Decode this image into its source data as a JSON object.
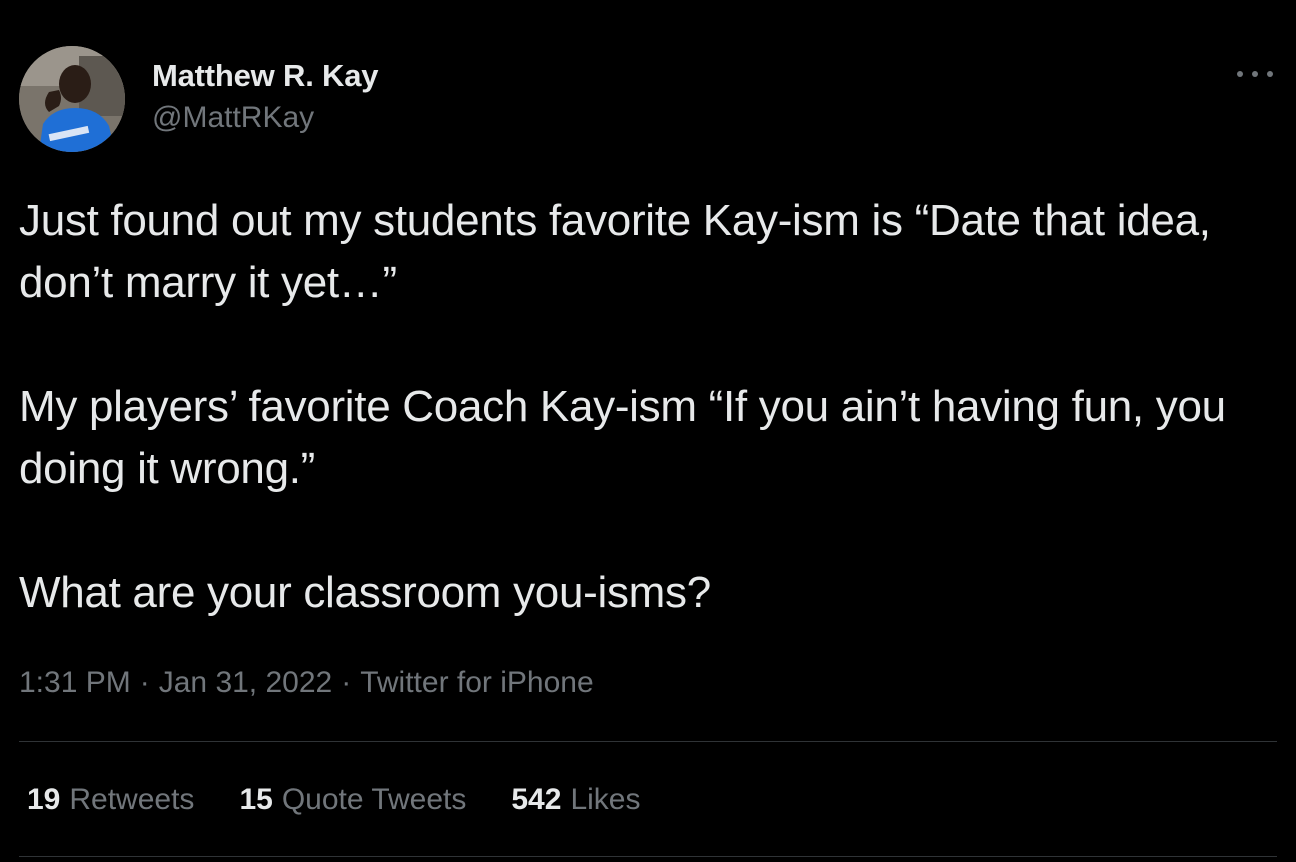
{
  "author": {
    "display_name": "Matthew R. Kay",
    "handle": "@MattRKay",
    "avatar_icon": "profile-photo"
  },
  "tweet": {
    "paragraphs": [
      "Just found out my students favorite Kay-ism is “Date that idea, don’t marry it yet…”",
      "My players’ favorite Coach Kay-ism “If you ain’t having fun, you doing it wrong.”",
      "What are your classroom you-isms?"
    ]
  },
  "meta": {
    "time": "1:31 PM",
    "date": "Jan 31, 2022",
    "source": "Twitter for iPhone",
    "separator": "·"
  },
  "stats": {
    "retweets_count": "19",
    "retweets_label": "Retweets",
    "quote_tweets_count": "15",
    "quote_tweets_label": "Quote Tweets",
    "likes_count": "542",
    "likes_label": "Likes"
  },
  "colors": {
    "background": "#000000",
    "primary_text": "#e7e9ea",
    "secondary_text": "#71767b",
    "divider": "#2f3336"
  }
}
